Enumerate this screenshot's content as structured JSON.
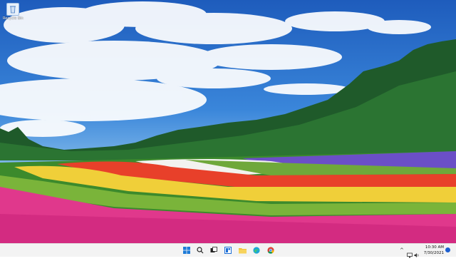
{
  "desktop": {
    "icons": [
      {
        "label": "Recycle Bin"
      }
    ]
  },
  "taskbar": {
    "pinned": [
      "start-icon",
      "search-icon",
      "task-view-icon",
      "widgets-icon",
      "file-explorer-icon",
      "edge-icon",
      "chrome-icon"
    ],
    "system_tray": {
      "overflow_chevron": "^",
      "time": "10:30 AM",
      "date": "7/30/2021"
    }
  },
  "colors": {
    "taskbar_bg": "#f3f3f3",
    "accent_blue": "#1d6fd6"
  }
}
